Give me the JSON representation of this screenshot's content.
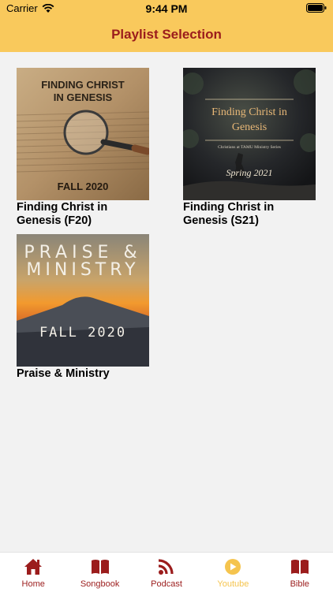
{
  "status": {
    "carrier": "Carrier",
    "time": "9:44 PM"
  },
  "header": {
    "title": "Playlist Selection"
  },
  "playlists": [
    {
      "title": "Finding Christ in Genesis (F20)",
      "art_lines": [
        "FINDING CHRIST",
        "IN GENESIS",
        "FALL 2020"
      ]
    },
    {
      "title": "Finding Christ in Genesis (S21)",
      "art_lines": [
        "Finding Christ in",
        "Genesis",
        "Christians at TAMU Ministry Series",
        "Spring 2021"
      ]
    },
    {
      "title": "Praise & Ministry",
      "art_lines": [
        "PRAISE &",
        "MINISTRY",
        "FALL 2020"
      ]
    }
  ],
  "tabs": [
    {
      "label": "Home",
      "icon": "home-icon",
      "active": false
    },
    {
      "label": "Songbook",
      "icon": "book-icon",
      "active": false
    },
    {
      "label": "Podcast",
      "icon": "podcast-icon",
      "active": false
    },
    {
      "label": "Youtube",
      "icon": "play-icon",
      "active": true
    },
    {
      "label": "Bible",
      "icon": "bible-icon",
      "active": false
    }
  ],
  "colors": {
    "accent": "#f9c95c",
    "brand_red": "#9b1c1c",
    "active_tab": "#f5c44e"
  }
}
